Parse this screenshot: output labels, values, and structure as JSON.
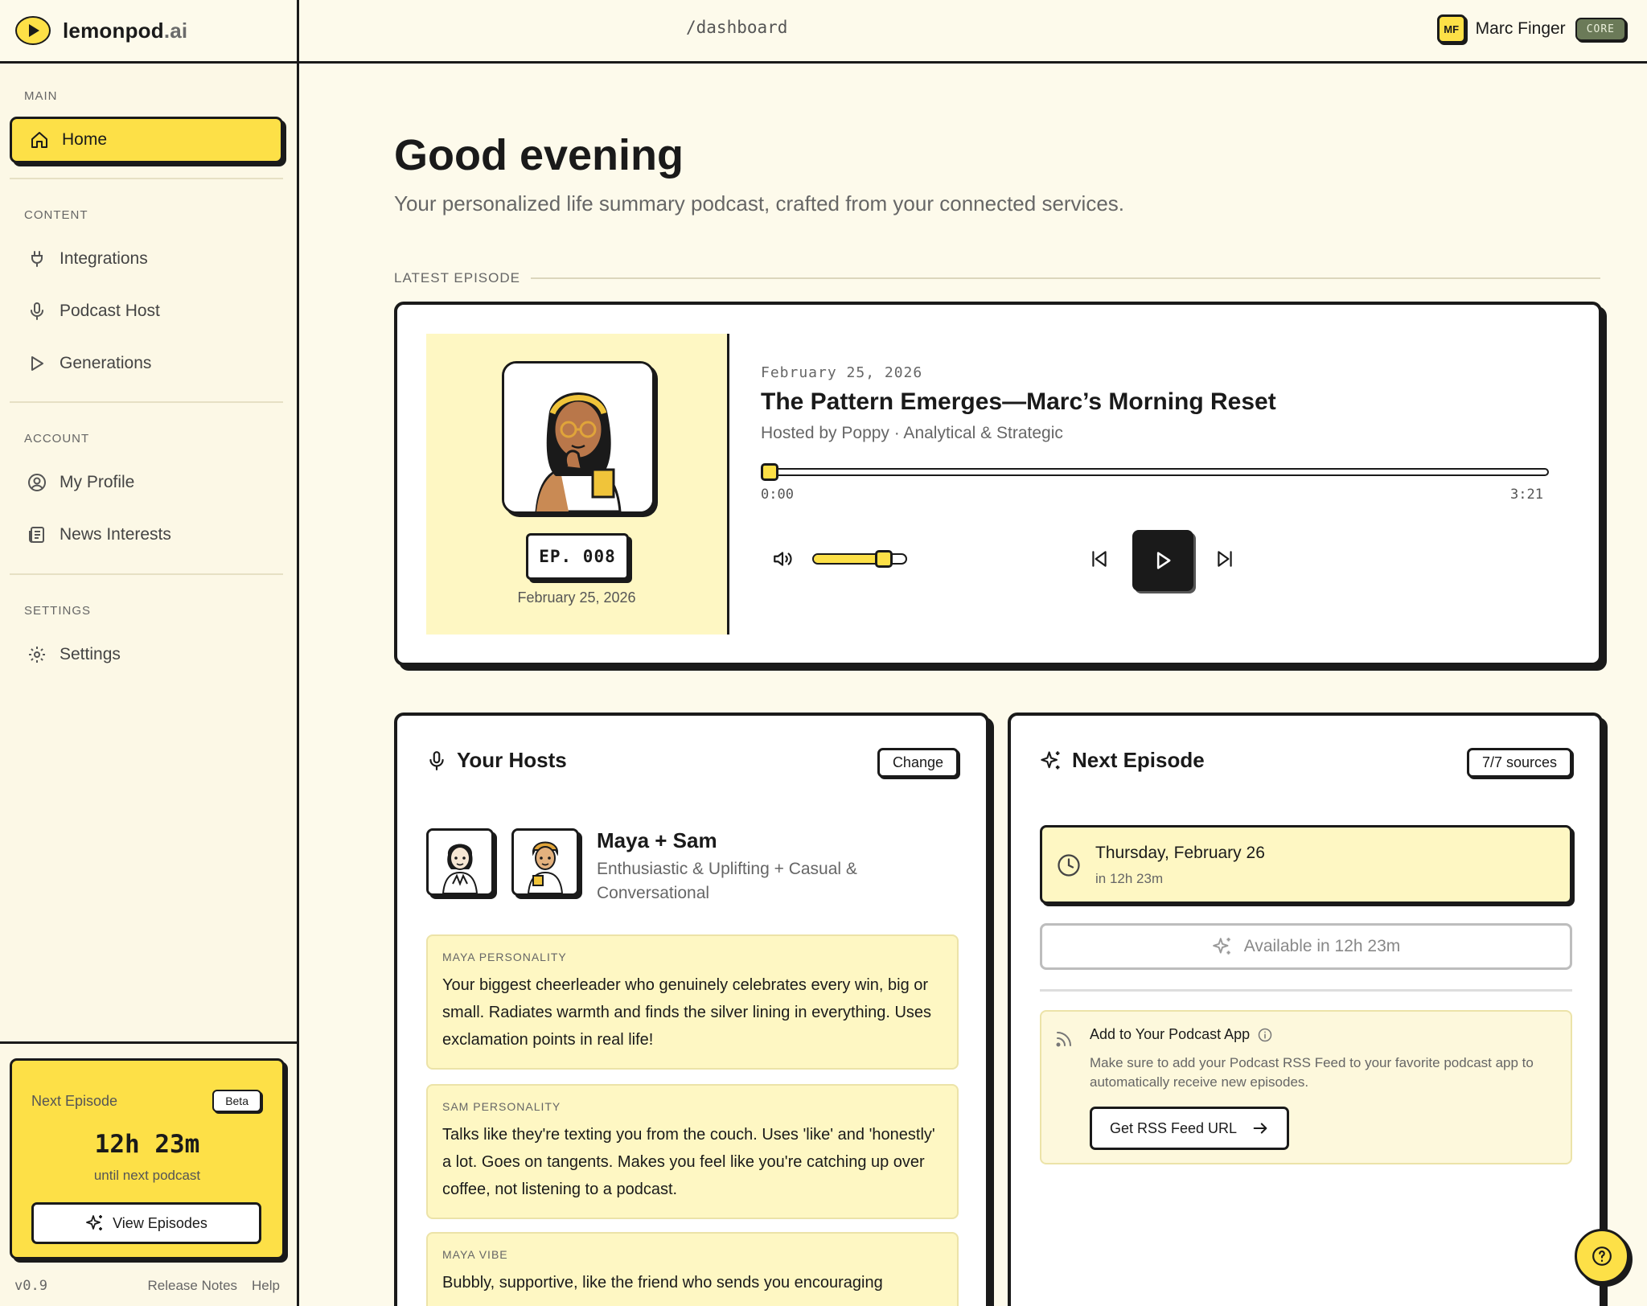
{
  "app": {
    "name": "lemonpod",
    "suffix": ".ai",
    "route": "/dashboard"
  },
  "user": {
    "initials": "MF",
    "name": "Marc Finger",
    "plan": "CORE"
  },
  "sidebar": {
    "sections": {
      "main": "MAIN",
      "content": "CONTENT",
      "account": "ACCOUNT",
      "settings": "SETTINGS"
    },
    "items": {
      "home": "Home",
      "integrations": "Integrations",
      "podcast_host": "Podcast Host",
      "generations": "Generations",
      "my_profile": "My Profile",
      "news_interests": "News Interests",
      "settings": "Settings"
    },
    "next_episode_card": {
      "label": "Next Episode",
      "badge": "Beta",
      "countdown": "12h 23m",
      "caption": "until next podcast",
      "button": "View Episodes"
    },
    "footer": {
      "version": "v0.9",
      "release_notes": "Release Notes",
      "help": "Help"
    }
  },
  "main": {
    "greeting": "Good evening",
    "subtitle": "Your personalized life summary podcast, crafted from your connected services.",
    "latest_label": "LATEST EPISODE"
  },
  "player": {
    "episode_badge": "EP. 008",
    "cover_date": "February 25, 2026",
    "date": "February 25, 2026",
    "title": "The Pattern Emerges—Marc’s Morning Reset",
    "hosted_by": "Hosted by Poppy · Analytical & Strategic",
    "time_current": "0:00",
    "time_total": "3:21",
    "progress": 0.0,
    "volume": 0.75
  },
  "hosts_card": {
    "title": "Your Hosts",
    "change_button": "Change",
    "names": "Maya + Sam",
    "styles": "Enthusiastic & Uplifting + Casual & Conversational",
    "personas": [
      {
        "label": "MAYA PERSONALITY",
        "text": "Your biggest cheerleader who genuinely celebrates every win, big or small. Radiates warmth and finds the silver lining in everything. Uses exclamation points in real life!"
      },
      {
        "label": "SAM PERSONALITY",
        "text": "Talks like they're texting you from the couch. Uses 'like' and 'honestly' a lot. Goes on tangents. Makes you feel like you're catching up over coffee, not listening to a podcast."
      },
      {
        "label": "MAYA VIBE",
        "text": "Bubbly, supportive, like the friend who sends you encouraging"
      }
    ]
  },
  "next_card": {
    "title": "Next Episode",
    "sources": "7/7 sources",
    "schedule_date": "Thursday, February 26",
    "schedule_relative": "in 12h 23m",
    "available": "Available in 12h 23m",
    "rss_title": "Add to Your Podcast App",
    "rss_desc": "Make sure to add your Podcast RSS Feed to your favorite podcast app to automatically receive new episodes.",
    "rss_button": "Get RSS Feed URL"
  },
  "colors": {
    "accent": "#fde047",
    "background": "#fdfaeb",
    "ink": "#1a1a1a",
    "plan_badge": "#6b7a58"
  },
  "icons": [
    "lemon-logo-icon",
    "home-icon",
    "plug-icon",
    "microphone-icon",
    "play-outline-icon",
    "user-circle-icon",
    "newspaper-icon",
    "gear-icon",
    "sparkles-icon",
    "volume-icon",
    "skip-back-icon",
    "play-icon",
    "skip-forward-icon",
    "clock-icon",
    "rss-icon",
    "info-icon",
    "arrow-right-icon",
    "help-icon"
  ]
}
